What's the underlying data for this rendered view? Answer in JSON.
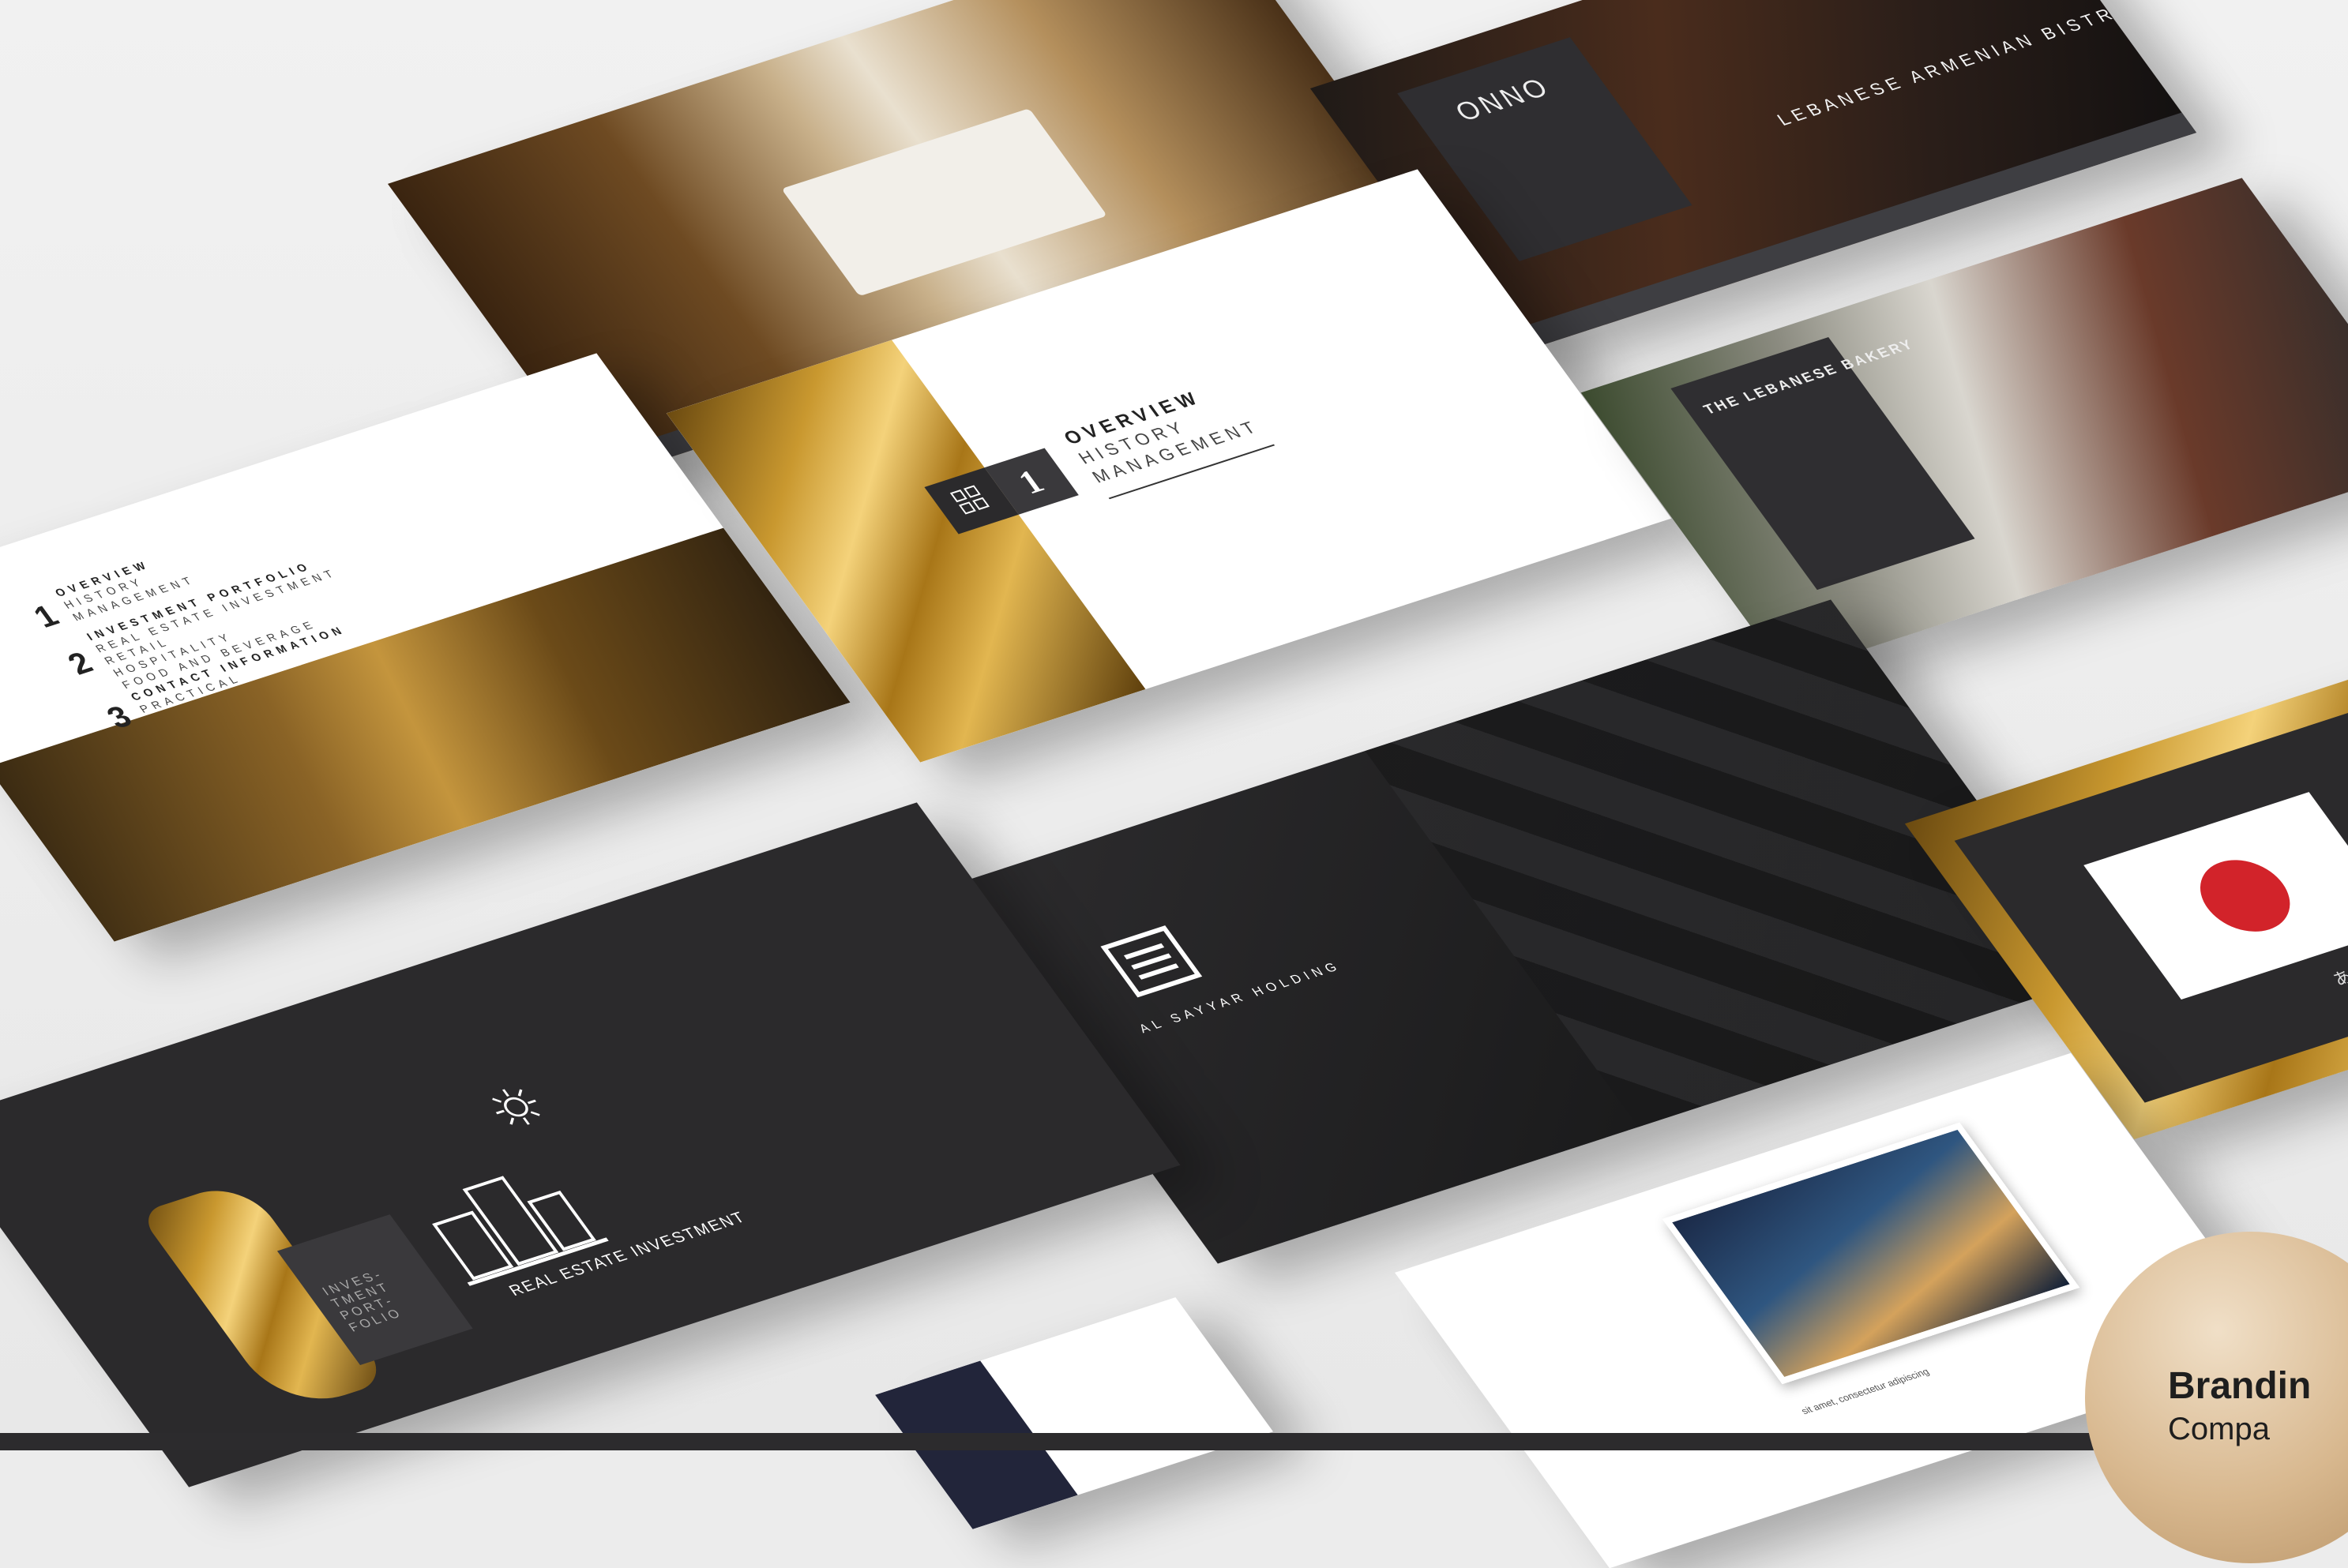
{
  "slides": {
    "toc": {
      "items": [
        {
          "num": "1",
          "lines": [
            "OVERVIEW",
            "HISTORY",
            "MANAGEMENT"
          ]
        },
        {
          "num": "2",
          "lines": [
            "INVESTMENT PORTFOLIO",
            "REAL ESTATE INVESTMENT",
            "RETAIL",
            "HOSPITALITY",
            "FOOD AND BEVERAGE"
          ]
        },
        {
          "num": "3",
          "lines": [
            "CONTACT INFORMATION",
            "PRACTICAL"
          ]
        }
      ]
    },
    "overview": {
      "num": "1",
      "lines": [
        "OVERVIEW",
        "HISTORY",
        "MANAGEMENT"
      ]
    },
    "restaurant": {
      "logo": "ONNO",
      "tagline": "LEBANESE ARMENIAN BISTRO"
    },
    "bakery": {
      "title": "THE LEBANESE BAKERY"
    },
    "holding": {
      "name": "AL SAYYAR HOLDING"
    },
    "portfolio": {
      "box_text": "INVES-TMENT PORT-FOLIO",
      "caption": "REAL ESTATE INVESTMENT"
    },
    "japan": {
      "script": "ありが"
    },
    "city": {
      "text": "sit amet, consectetur adipiscing"
    }
  },
  "badge": {
    "title": "Brandin",
    "subtitle": "Compa"
  },
  "colors": {
    "dark": "#2b2a2c",
    "gold": "#c9982f",
    "red": "#d2232a"
  }
}
